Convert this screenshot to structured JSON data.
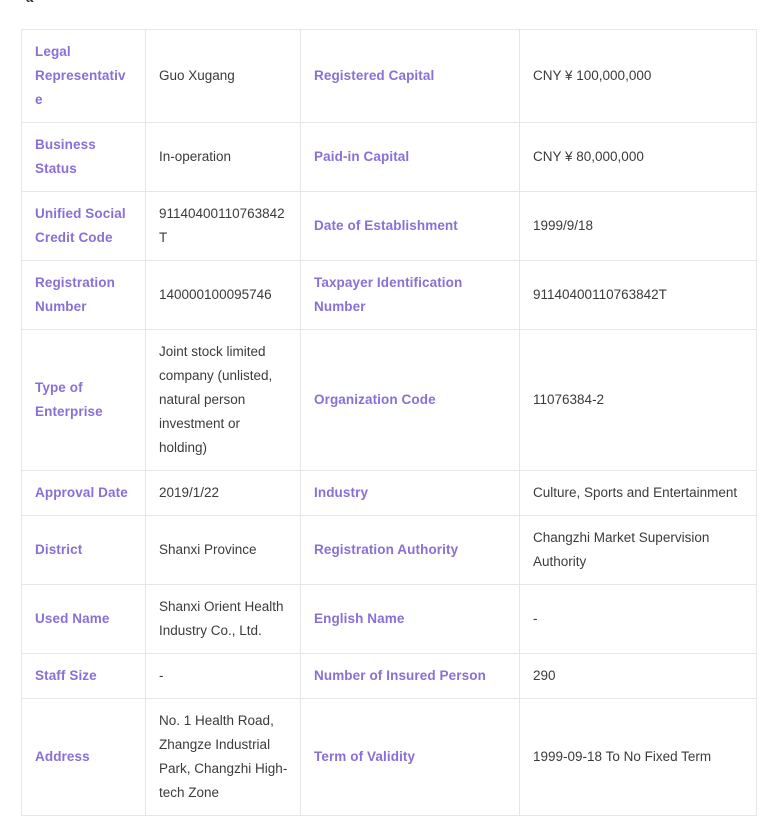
{
  "top_fragment": "a",
  "colors": {
    "label_purple": "#8a6fd6",
    "value_text": "#3b3b3b",
    "border": "#e6e6ea",
    "background": "#ffffff"
  },
  "table": {
    "rows": [
      {
        "label_a": "Legal Representative",
        "value_a": "Guo Xugang",
        "label_b": "Registered Capital",
        "value_b": "CNY ¥ 100,000,000"
      },
      {
        "label_a": "Business Status",
        "value_a": "In-operation",
        "label_b": "Paid-in Capital",
        "value_b": "CNY ¥ 80,000,000"
      },
      {
        "label_a": "Unified Social Credit Code",
        "value_a": "91140400110763842T",
        "label_b": "Date of Establishment",
        "value_b": "1999/9/18"
      },
      {
        "label_a": "Registration Number",
        "value_a": "140000100095746",
        "label_b": "Taxpayer Identification Number",
        "value_b": "91140400110763842T"
      },
      {
        "label_a": "Type of Enterprise",
        "value_a": "Joint stock limited company (unlisted, natural person investment or holding)",
        "label_b": "Organization Code",
        "value_b": "11076384-2"
      },
      {
        "label_a": "Approval Date",
        "value_a": "2019/1/22",
        "label_b": "Industry",
        "value_b": "Culture, Sports and Entertainment"
      },
      {
        "label_a": "District",
        "value_a": "Shanxi Province",
        "label_b": "Registration Authority",
        "value_b": "Changzhi Market Supervision Authority"
      },
      {
        "label_a": "Used Name",
        "value_a": "Shanxi Orient Health Industry Co., Ltd.",
        "label_b": "English Name",
        "value_b": "-"
      },
      {
        "label_a": "Staff Size",
        "value_a": "-",
        "label_b": "Number of Insured Person",
        "value_b": "290"
      },
      {
        "label_a": "Address",
        "value_a": "No. 1 Health Road, Zhangze Industrial Park, Changzhi High-tech Zone",
        "label_b": "Term of Validity",
        "value_b": "1999-09-18 To No Fixed Term"
      }
    ]
  }
}
